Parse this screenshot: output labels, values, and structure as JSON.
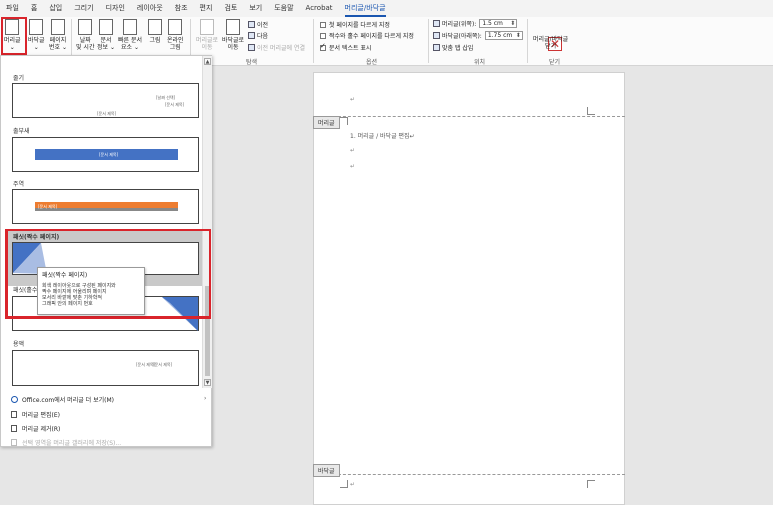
{
  "tabs": [
    "파일",
    "홈",
    "삽입",
    "그리기",
    "디자인",
    "레이아웃",
    "참조",
    "편지",
    "검토",
    "보기",
    "도움말",
    "Acrobat",
    "머리글/바닥글"
  ],
  "ribbon": {
    "header_btn": [
      "머리글",
      "⌄"
    ],
    "footer_btn": [
      "바닥글",
      "⌄"
    ],
    "pagenum_btn": [
      "페이지",
      "번호 ⌄"
    ],
    "datetime_btn": [
      "날짜",
      "및 시간"
    ],
    "docinfo_btn": [
      "문서",
      "정보 ⌄"
    ],
    "quickparts_btn": [
      "빠른 문서",
      "요소 ⌄"
    ],
    "picture_btn": [
      "그림",
      ""
    ],
    "onlinepic_btn": [
      "온라인",
      "그림"
    ],
    "goto_header_btn": [
      "머리글로",
      "이동"
    ],
    "goto_footer_btn": [
      "바닥글로",
      "이동"
    ],
    "prev": "이전",
    "next": "다음",
    "link_prev": "이전 머리글에 연결",
    "nav_label": "탐색",
    "opt_first": "첫 페이지를 다르게 지정",
    "opt_oddeven": "짝수와 홀수 페이지를 다르게 지정",
    "opt_showtext": "문서 텍스트 표시",
    "options_label": "옵션",
    "header_top": "머리글(위쪽):",
    "header_top_val": "1.5 cm",
    "footer_bottom": "바닥글(아래쪽):",
    "footer_bottom_val": "1.75 cm",
    "align_tab": "맞춤 탭 삽입",
    "position_label": "위치",
    "close_btn": [
      "머리글/바닥글",
      "닫기"
    ],
    "close_label": "닫기"
  },
  "gallery": {
    "items": [
      {
        "name": "줄기",
        "thumb_lines": [
          "[날짜 선택]",
          "[문서 제목]",
          "[문서 제목]"
        ]
      },
      {
        "name": "출부새",
        "thumb_lines": [
          "[문서 제목]"
        ]
      },
      {
        "name": "주역",
        "thumb_lines": [
          "[문서 제목]"
        ]
      },
      {
        "name": "패싯(짝수 페이지)",
        "thumb_lines": []
      },
      {
        "name": "패싯(홀수 페이지)",
        "thumb_lines": []
      },
      {
        "name": "용액",
        "thumb_lines": [
          "[문서 제목]",
          "[문서 제목]"
        ]
      }
    ],
    "tooltip": {
      "title": "패싯(짝수 페이지)",
      "lines": [
        "회색 레이아웃으로 구성된 페이지와",
        "짝수 페이지에 어울리며 페이지",
        "모서리 바깥에 맞춘 기하학적",
        "그래픽 안의 페이지 번호"
      ]
    },
    "menu": {
      "more": "Office.com에서 머리글 더 보기(M)",
      "edit": "머리글 편집(E)",
      "remove": "머리글 제거(R)",
      "save": "선택 영역을 머리글 갤러리에 저장(S)..."
    }
  },
  "document": {
    "header_tag": "머리글",
    "footer_tag": "바닥글",
    "para_mark": "↵",
    "body_line": "1. 머리글 / 바닥글 편집↵"
  },
  "colors": {
    "accent": "#1a56b0",
    "highlight_red": "#d9242b",
    "bar_blue": "#4472c4",
    "bar_orange": "#ed7d31"
  }
}
